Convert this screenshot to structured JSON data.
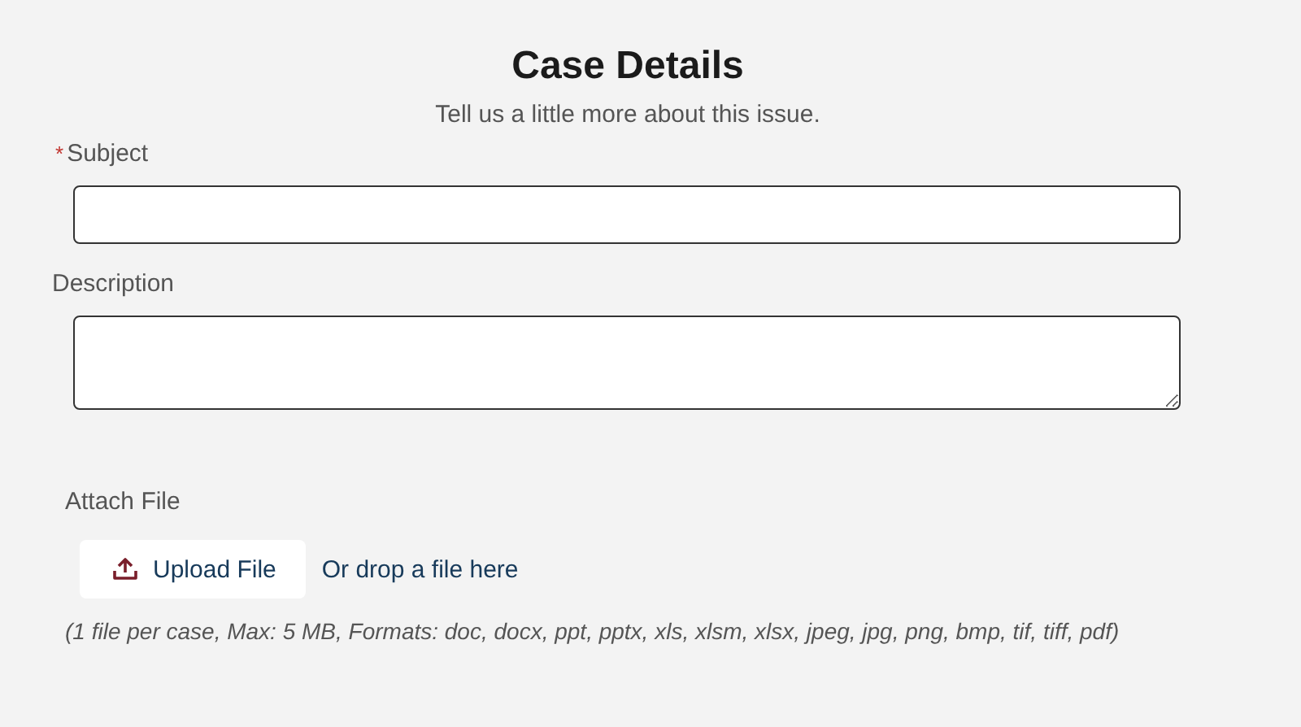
{
  "header": {
    "title": "Case Details",
    "subtitle": "Tell us a little more about this issue."
  },
  "fields": [
    {
      "kind": "text",
      "label": "Subject",
      "required_mark": "*"
    },
    {
      "kind": "textarea",
      "label": "Description"
    }
  ],
  "attachment": {
    "label": "Attach File",
    "button": "Upload File",
    "drop_hint": "Or drop a file here",
    "note": "(1 file per case, Max: 5 MB, Formats: doc, docx, ppt, pptx, xls, xlsm, xlsx, jpeg, jpg, png, bmp, tif, tiff, pdf)"
  }
}
